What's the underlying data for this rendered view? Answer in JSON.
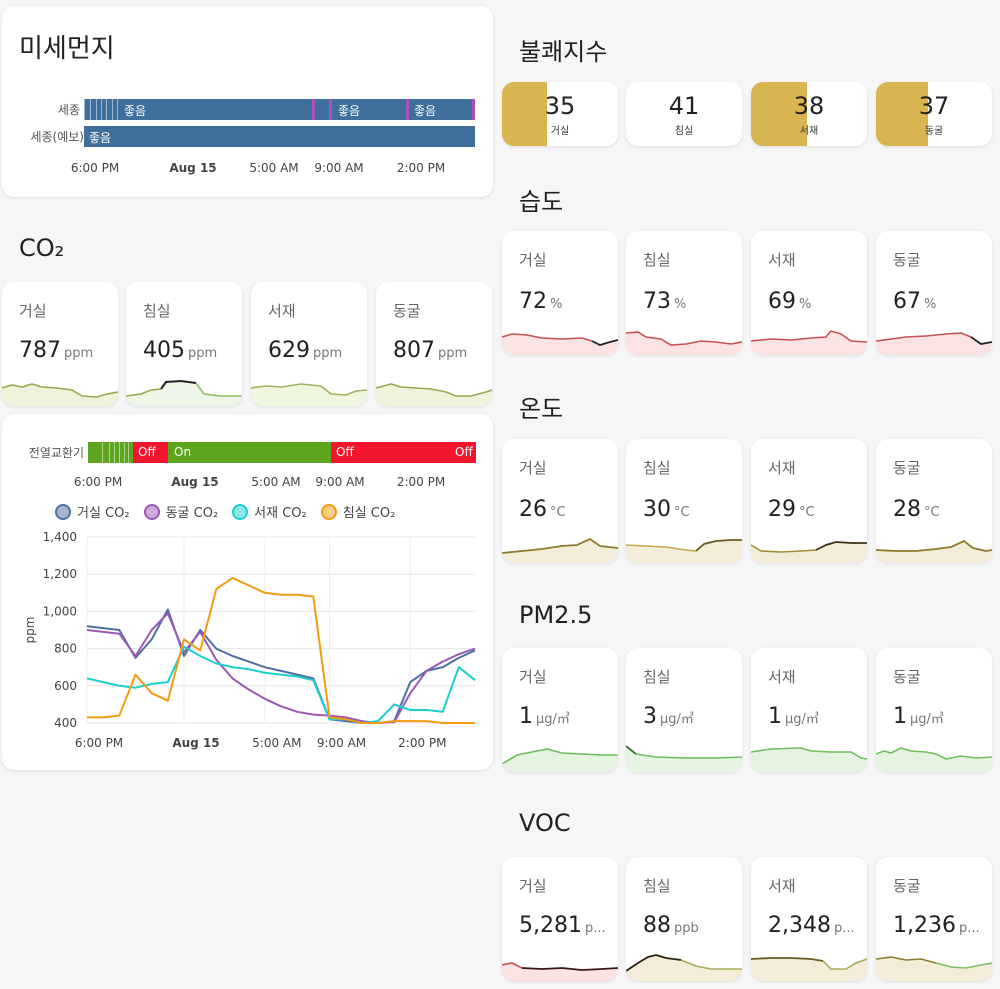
{
  "dust": {
    "title": "미세먼지",
    "rows": [
      {
        "label": "세종",
        "segments": [
          {
            "text": "좋음"
          },
          {
            "text": "좋음"
          },
          {
            "text": "좋음"
          }
        ]
      },
      {
        "label": "세종(예보)",
        "segments": [
          {
            "text": "좋음"
          }
        ]
      }
    ],
    "axis": [
      "6:00 PM",
      "Aug 15",
      "5:00 AM",
      "9:00 AM",
      "2:00 PM"
    ]
  },
  "co2": {
    "title": "CO₂",
    "tiles": [
      {
        "name": "거실",
        "value": "787",
        "unit": "ppm"
      },
      {
        "name": "침실",
        "value": "405",
        "unit": "ppm"
      },
      {
        "name": "서재",
        "value": "629",
        "unit": "ppm"
      },
      {
        "name": "동굴",
        "value": "807",
        "unit": "ppm"
      }
    ]
  },
  "erv": {
    "label": "전열교환기",
    "segments": [
      {
        "text": "Off"
      },
      {
        "text": "On"
      },
      {
        "text": "Off"
      },
      {
        "text": "Off"
      }
    ],
    "axis": [
      "6:00 PM",
      "Aug 15",
      "5:00 AM",
      "9:00 AM",
      "2:00 PM"
    ]
  },
  "colors": {
    "dust_good": "#3f6f9a",
    "erv_on": "#5ea51f",
    "erv_off": "#f1162e",
    "di_fill": "#d8b551",
    "living": "#4e6fa3",
    "cave": "#9b59b6",
    "study": "#1ccfcf",
    "bedroom": "#f39c12"
  },
  "chart_data": {
    "type": "line",
    "ylabel": "ppm",
    "ylim": [
      400,
      1400
    ],
    "yticks": [
      "1,400",
      "1,200",
      "1,000",
      "800",
      "600",
      "400"
    ],
    "xticks": [
      "6:00 PM",
      "Aug 15",
      "5:00 AM",
      "9:00 AM",
      "2:00 PM"
    ],
    "x_hours": [
      0,
      1,
      2,
      3,
      4,
      5,
      6,
      7,
      8,
      9,
      10,
      11,
      12,
      13,
      14,
      15,
      16,
      17,
      18,
      19,
      20,
      21,
      22,
      23,
      24
    ],
    "series": [
      {
        "name": "거실 CO₂",
        "color_key": "living",
        "values": [
          920,
          910,
          900,
          750,
          850,
          1010,
          760,
          900,
          800,
          760,
          730,
          700,
          680,
          660,
          640,
          420,
          410,
          400,
          400,
          410,
          620,
          680,
          700,
          750,
          790
        ]
      },
      {
        "name": "동굴 CO₂",
        "color_key": "cave",
        "values": [
          900,
          890,
          880,
          760,
          900,
          990,
          780,
          890,
          740,
          640,
          580,
          530,
          490,
          460,
          445,
          440,
          430,
          410,
          400,
          405,
          560,
          680,
          730,
          770,
          800
        ]
      },
      {
        "name": "서재 CO₂",
        "color_key": "study",
        "values": [
          640,
          620,
          600,
          590,
          610,
          620,
          810,
          760,
          720,
          700,
          690,
          670,
          660,
          650,
          630,
          420,
          420,
          400,
          410,
          500,
          470,
          470,
          460,
          700,
          630
        ]
      },
      {
        "name": "침실 CO₂",
        "color_key": "bedroom",
        "values": [
          430,
          430,
          440,
          660,
          560,
          520,
          850,
          790,
          1120,
          1180,
          1140,
          1100,
          1090,
          1090,
          1080,
          430,
          420,
          400,
          400,
          410,
          410,
          410,
          400,
          400,
          400
        ]
      }
    ]
  },
  "discomfort": {
    "title": "불쾌지수",
    "tiles": [
      {
        "name": "거실",
        "value": "35",
        "fill": 0.39
      },
      {
        "name": "침실",
        "value": "41",
        "fill": 0
      },
      {
        "name": "서재",
        "value": "38",
        "fill": 0.48
      },
      {
        "name": "동굴",
        "value": "37",
        "fill": 0.45
      }
    ]
  },
  "humidity": {
    "title": "습도",
    "tiles": [
      {
        "name": "거실",
        "value": "72",
        "unit": "%"
      },
      {
        "name": "침실",
        "value": "73",
        "unit": "%"
      },
      {
        "name": "서재",
        "value": "69",
        "unit": "%"
      },
      {
        "name": "동굴",
        "value": "67",
        "unit": "%"
      }
    ]
  },
  "temperature": {
    "title": "온도",
    "tiles": [
      {
        "name": "거실",
        "value": "26",
        "unit": "°C"
      },
      {
        "name": "침실",
        "value": "30",
        "unit": "°C"
      },
      {
        "name": "서재",
        "value": "29",
        "unit": "°C"
      },
      {
        "name": "동굴",
        "value": "28",
        "unit": "°C"
      }
    ]
  },
  "pm25": {
    "title": "PM2.5",
    "tiles": [
      {
        "name": "거실",
        "value": "1",
        "unit": "µg/㎥"
      },
      {
        "name": "침실",
        "value": "3",
        "unit": "µg/㎥"
      },
      {
        "name": "서재",
        "value": "1",
        "unit": "µg/㎥"
      },
      {
        "name": "동굴",
        "value": "1",
        "unit": "µg/㎥"
      }
    ]
  },
  "voc": {
    "title": "VOC",
    "tiles": [
      {
        "name": "거실",
        "value": "5,281",
        "unit": "p..."
      },
      {
        "name": "침실",
        "value": "88",
        "unit": "ppb"
      },
      {
        "name": "서재",
        "value": "2,348",
        "unit": "p..."
      },
      {
        "name": "동굴",
        "value": "1,236",
        "unit": "p..."
      }
    ]
  }
}
